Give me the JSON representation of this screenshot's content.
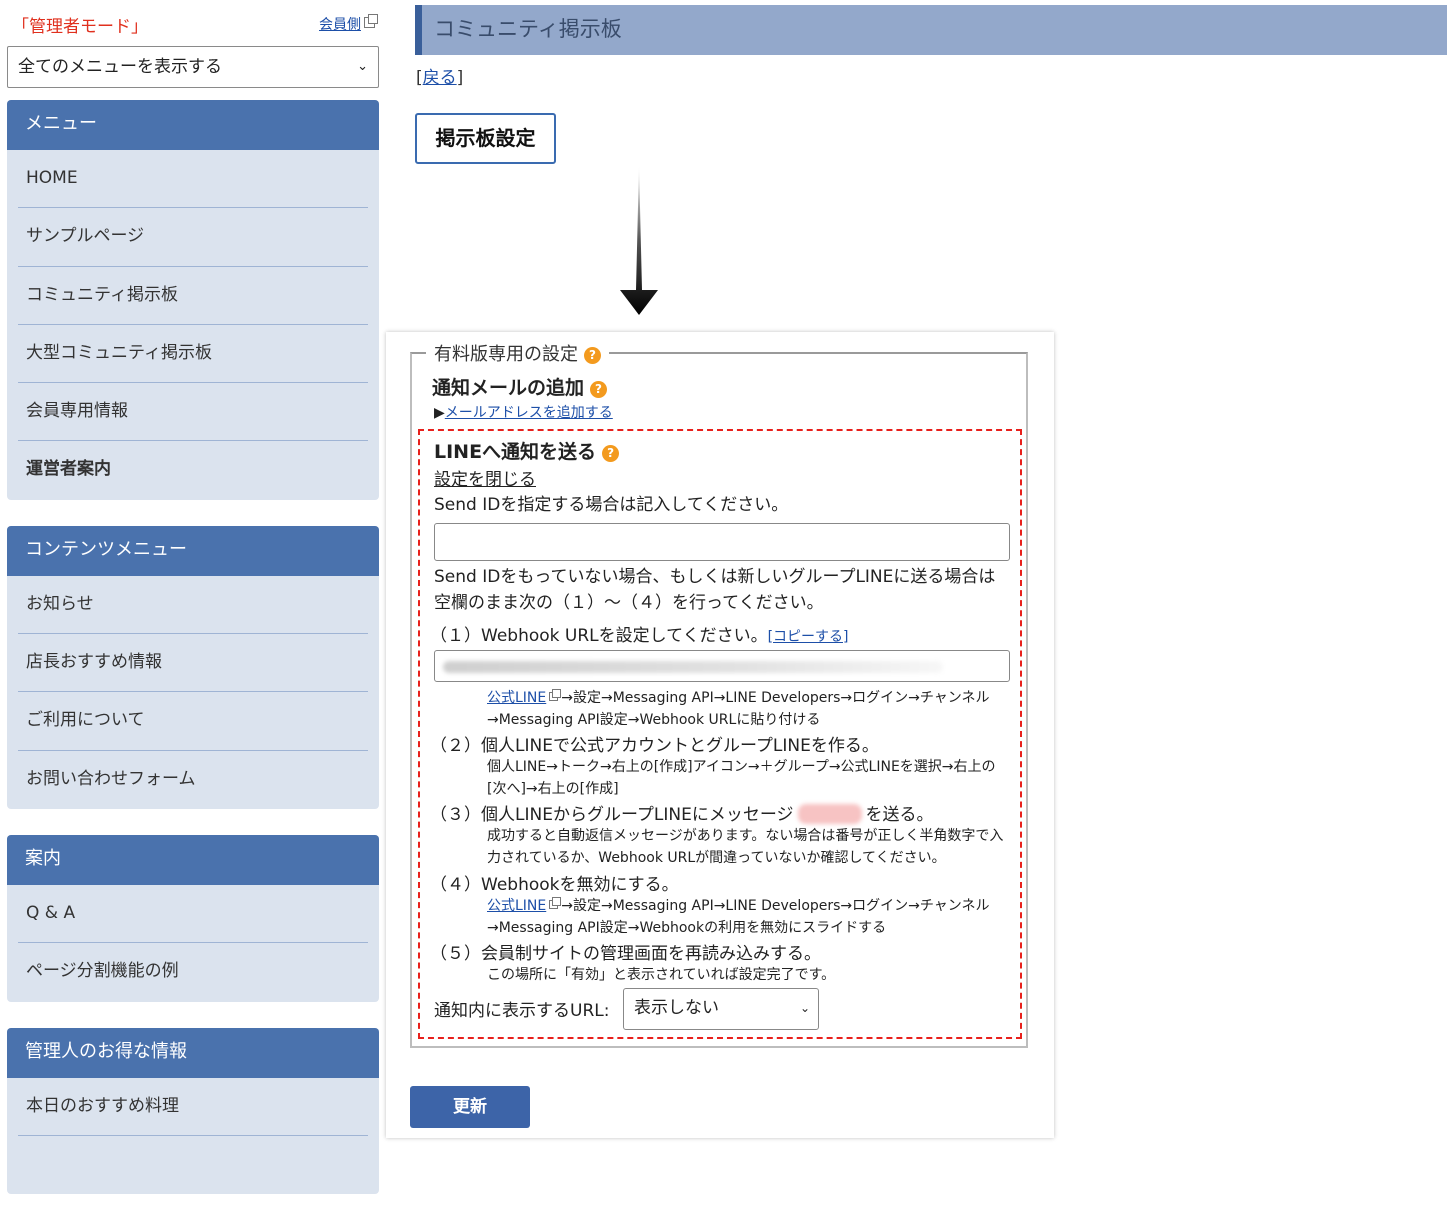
{
  "sidebar": {
    "admin_mode": "「管理者モード」",
    "member_link": "会員側",
    "menu_select": "全てのメニューを表示する",
    "menus": [
      {
        "title": "メニュー",
        "items": [
          {
            "label": "HOME"
          },
          {
            "label": "サンプルページ"
          },
          {
            "label": "コミュニティ掲示板"
          },
          {
            "label": "大型コミュニティ掲示板"
          },
          {
            "label": "会員専用情報"
          },
          {
            "label": "運営者案内"
          }
        ]
      },
      {
        "title": "コンテンツメニュー",
        "items": [
          {
            "label": "お知らせ"
          },
          {
            "label": "店長おすすめ情報"
          },
          {
            "label": "ご利用について"
          },
          {
            "label": "お問い合わせフォーム"
          }
        ]
      },
      {
        "title": "案内",
        "items": [
          {
            "label": "Q & A"
          },
          {
            "label": "ページ分割機能の例"
          }
        ]
      },
      {
        "title": "管理人のお得な情報",
        "items": [
          {
            "label": "本日のおすすめ料理"
          }
        ]
      }
    ]
  },
  "main": {
    "title": "コミュニティ掲示板",
    "back_open": "[",
    "back_link": "戻る",
    "back_close": "]",
    "board_settings": "掲示板設定"
  },
  "panel": {
    "legend": "有料版専用の設定",
    "notif_title": "通知メールの追加",
    "add_mail_prefix": "▶",
    "add_mail_link": "メールアドレスを追加する",
    "line_title": "LINEへ通知を送る",
    "close_link": "設定を閉じる",
    "send_hint": "Send IDを指定する場合は記入してください。",
    "send_input_value": "",
    "send_desc": "Send IDをもっていない場合、もしくは新しいグループLINEに送る場合は空欄のまま次の（１）～（４）を行ってください。",
    "step1": "（１）Webhook URLを設定してください。",
    "copy_link": "[コピーする]",
    "official_line": "公式LINE",
    "note1": "→設定→Messaging API→LINE Developers→ログイン→チャンネル→Messaging API設定→Webhook URLに貼り付ける",
    "step2": "（２）個人LINEで公式アカウントとグループLINEを作る。",
    "note2": "個人LINE→トーク→右上の[作成]アイコン→＋グループ→公式LINEを選択→右上の[次へ]→右上の[作成]",
    "step3_pre": "（３）個人LINEからグループLINEにメッセージ",
    "step3_post": "を送る。",
    "note3": "成功すると自動返信メッセージがあります。ない場合は番号が正しく半角数字で入力されているか、Webhook URLが間違っていないか確認してください。",
    "step4": "（４）Webhookを無効にする。",
    "note4": "→設定→Messaging API→LINE Developers→ログイン→チャンネル→Messaging API設定→Webhookの利用を無効にスライドする",
    "step5": "（５）会員制サイトの管理画面を再読み込みする。",
    "note5": "この場所に「有効」と表示されていれば設定完了です。",
    "url_label": "通知内に表示するURL:",
    "url_select": "表示しない",
    "update_button": "更新"
  },
  "colors": {
    "accent": "#4a72ad",
    "title_bar": "#93a8cb",
    "dashed_border": "#e8201c",
    "help_icon": "#f39a1e"
  },
  "icons": [
    "external-link-icon",
    "help-icon",
    "down-arrow-icon",
    "chevron-down-icon"
  ]
}
